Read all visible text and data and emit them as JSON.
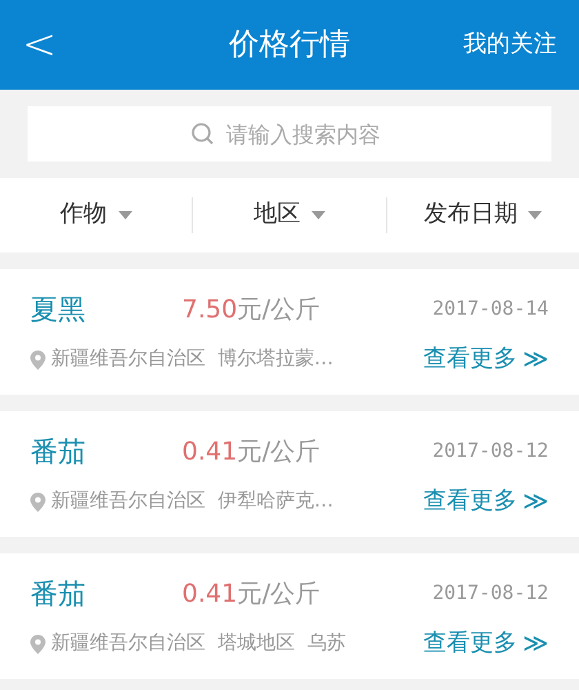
{
  "header": {
    "back": "<",
    "title": "价格行情",
    "action": "我的关注"
  },
  "search": {
    "placeholder": "请输入搜索内容"
  },
  "filters": [
    {
      "label": "作物"
    },
    {
      "label": "地区"
    },
    {
      "label": "发布日期"
    }
  ],
  "items": [
    {
      "crop": "夏黑",
      "price": "7.50",
      "unit": "元/公斤",
      "date": "2017-08-14",
      "location": "新疆维吾尔自治区  博尔塔拉蒙…",
      "more": "查看更多",
      "more_icon": "≫"
    },
    {
      "crop": "番茄",
      "price": "0.41",
      "unit": "元/公斤",
      "date": "2017-08-12",
      "location": "新疆维吾尔自治区  伊犁哈萨克…",
      "more": "查看更多",
      "more_icon": "≫"
    },
    {
      "crop": "番茄",
      "price": "0.41",
      "unit": "元/公斤",
      "date": "2017-08-12",
      "location": "新疆维吾尔自治区  塔城地区  乌苏",
      "more": "查看更多",
      "more_icon": "≫"
    }
  ]
}
